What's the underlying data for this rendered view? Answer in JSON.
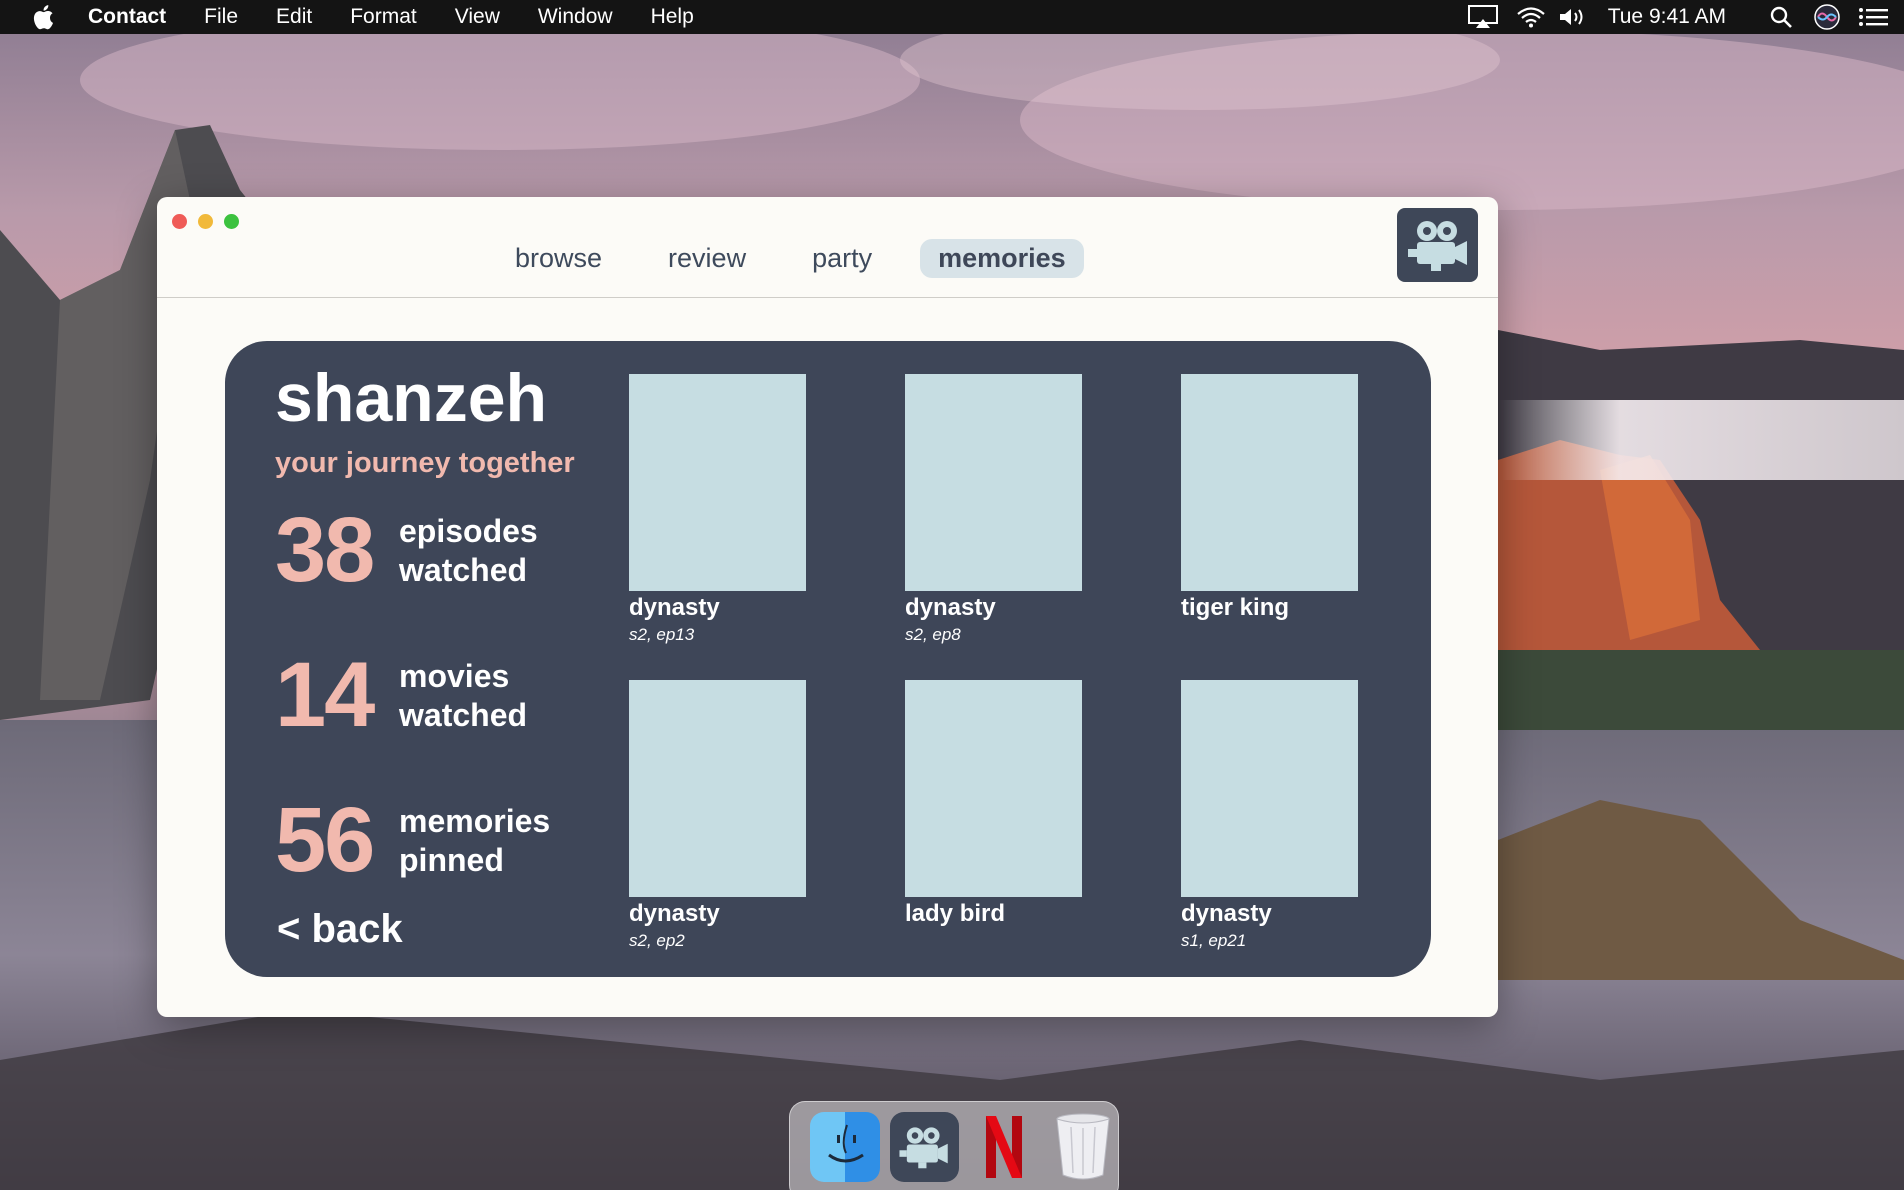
{
  "menubar": {
    "app_name": "Contact",
    "menus": [
      "File",
      "Edit",
      "Format",
      "View",
      "Window",
      "Help"
    ],
    "clock": "Tue 9:41 AM",
    "icons": [
      "apple-icon",
      "airplay-icon",
      "wifi-icon",
      "volume-icon",
      "search-icon",
      "siri-icon",
      "notification-center-icon"
    ]
  },
  "window": {
    "tabs": [
      {
        "label": "browse",
        "active": false
      },
      {
        "label": "review",
        "active": false
      },
      {
        "label": "party",
        "active": false
      },
      {
        "label": "memories",
        "active": true
      }
    ],
    "logo_icon": "movie-camera-icon"
  },
  "memories": {
    "user_name": "shanzeh",
    "subtitle": "your journey together",
    "stats": [
      {
        "value": "38",
        "label_line1": "episodes",
        "label_line2": "watched"
      },
      {
        "value": "14",
        "label_line1": "movies",
        "label_line2": "watched"
      },
      {
        "value": "56",
        "label_line1": "memories",
        "label_line2": "pinned"
      }
    ],
    "back_label": "< back",
    "posters": [
      {
        "title": "dynasty",
        "episode": "s2, ep13"
      },
      {
        "title": "dynasty",
        "episode": "s2, ep8"
      },
      {
        "title": "tiger king",
        "episode": ""
      },
      {
        "title": "dynasty",
        "episode": "s2, ep2"
      },
      {
        "title": "lady bird",
        "episode": ""
      },
      {
        "title": "dynasty",
        "episode": "s1, ep21"
      }
    ]
  },
  "dock": {
    "items": [
      "finder-icon",
      "contact-app-icon",
      "netflix-icon",
      "trash-icon"
    ]
  },
  "colors": {
    "panel": "#3e4658",
    "accent": "#f1b9ae",
    "poster_placeholder": "#c6dde2",
    "active_tab": "#d8e3e8"
  }
}
